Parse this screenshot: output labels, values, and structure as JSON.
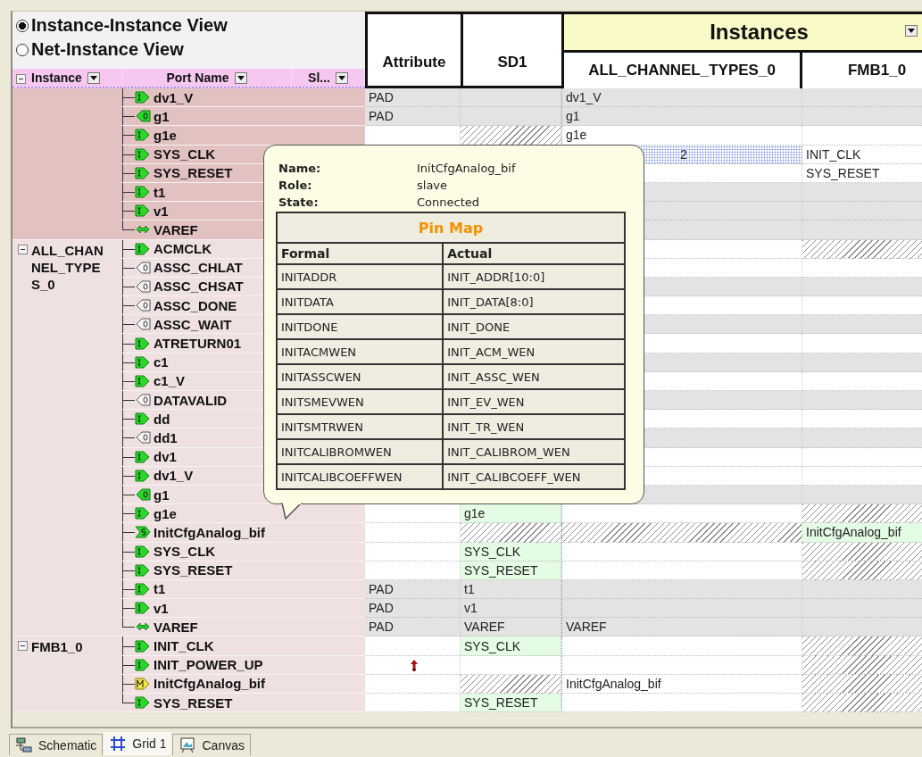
{
  "view_options": [
    {
      "label": "Instance-Instance View",
      "selected": true
    },
    {
      "label": "Net-Instance View",
      "selected": false
    }
  ],
  "left_columns": [
    "Instance",
    "Port Name",
    "Sl..."
  ],
  "right_columns": {
    "attribute": "Attribute",
    "sd1": "SD1",
    "group": "Instances",
    "instances": [
      "ALL_CHANNEL_TYPES_0",
      "FMB1_0"
    ]
  },
  "groups": [
    {
      "highlighted": true,
      "ports": [
        {
          "name": "dv1_V",
          "kind": "in",
          "cells": [
            {
              "kind": "gray",
              "text": "PAD"
            },
            {
              "kind": "gray"
            },
            {
              "kind": "gray",
              "text": "dv1_V"
            },
            {
              "kind": "gray"
            }
          ]
        },
        {
          "name": "g1",
          "kind": "out",
          "cells": [
            {
              "kind": "gray",
              "text": "PAD"
            },
            {
              "kind": "gray"
            },
            {
              "kind": "gray",
              "text": "g1"
            },
            {
              "kind": "gray"
            }
          ]
        },
        {
          "name": "g1e",
          "kind": "in",
          "cells": [
            {
              "kind": "plain"
            },
            {
              "kind": "hatch"
            },
            {
              "kind": "plain",
              "text": "g1e"
            },
            {
              "kind": "plain"
            }
          ]
        },
        {
          "name": "SYS_CLK",
          "kind": "in",
          "cells": [
            null,
            null,
            {
              "kind": "dots",
              "text": "2"
            },
            {
              "kind": "plain",
              "text": "INIT_CLK"
            }
          ]
        },
        {
          "name": "SYS_RESET",
          "kind": "in",
          "cells": [
            null,
            null,
            {
              "kind": "plain"
            },
            {
              "kind": "plain",
              "text": "SYS_RESET"
            }
          ]
        },
        {
          "name": "t1",
          "kind": "in",
          "cells": [
            null,
            null,
            {
              "kind": "gray"
            },
            {
              "kind": "gray"
            }
          ]
        },
        {
          "name": "v1",
          "kind": "in",
          "cells": [
            null,
            null,
            {
              "kind": "gray"
            },
            {
              "kind": "gray"
            }
          ]
        },
        {
          "name": "VAREF",
          "kind": "inout",
          "cells": [
            null,
            null,
            {
              "kind": "gray"
            },
            {
              "kind": "gray"
            }
          ]
        }
      ]
    },
    {
      "instance": "ALL_CHANNEL_TYPES_0",
      "highlighted": false,
      "expanded": true,
      "ports": [
        {
          "name": "ACMCLK",
          "kind": "in",
          "cells": [
            null,
            null,
            {
              "kind": "plain"
            },
            {
              "kind": "hatch"
            }
          ]
        },
        {
          "name": "ASSC_CHLAT",
          "kind": "floating",
          "cells": [
            null,
            null,
            {
              "kind": "plain"
            },
            {
              "kind": "plain"
            }
          ]
        },
        {
          "name": "ASSC_CHSAT",
          "kind": "floating",
          "cells": [
            null,
            null,
            {
              "kind": "gray"
            },
            {
              "kind": "gray"
            }
          ]
        },
        {
          "name": "ASSC_DONE",
          "kind": "floating",
          "cells": [
            null,
            null,
            {
              "kind": "plain"
            },
            {
              "kind": "plain"
            }
          ]
        },
        {
          "name": "ASSC_WAIT",
          "kind": "floating",
          "cells": [
            null,
            null,
            {
              "kind": "gray"
            },
            {
              "kind": "gray"
            }
          ]
        },
        {
          "name": "ATRETURN01",
          "kind": "in",
          "cells": [
            null,
            null,
            {
              "kind": "plain"
            },
            {
              "kind": "plain"
            }
          ]
        },
        {
          "name": "c1",
          "kind": "in",
          "cells": [
            null,
            null,
            {
              "kind": "gray"
            },
            {
              "kind": "gray"
            }
          ]
        },
        {
          "name": "c1_V",
          "kind": "in",
          "cells": [
            null,
            null,
            {
              "kind": "plain"
            },
            {
              "kind": "plain"
            }
          ]
        },
        {
          "name": "DATAVALID",
          "kind": "floating",
          "cells": [
            null,
            null,
            {
              "kind": "gray"
            },
            {
              "kind": "gray"
            }
          ]
        },
        {
          "name": "dd",
          "kind": "in",
          "cells": [
            null,
            null,
            {
              "kind": "plain"
            },
            {
              "kind": "plain"
            }
          ]
        },
        {
          "name": "dd1",
          "kind": "floating",
          "cells": [
            null,
            null,
            {
              "kind": "gray"
            },
            {
              "kind": "gray"
            }
          ]
        },
        {
          "name": "dv1",
          "kind": "in",
          "cells": [
            null,
            null,
            {
              "kind": "plain"
            },
            {
              "kind": "plain"
            }
          ]
        },
        {
          "name": "dv1_V",
          "kind": "in",
          "cells": [
            null,
            null,
            {
              "kind": "plain"
            },
            {
              "kind": "plain"
            }
          ]
        },
        {
          "name": "g1",
          "kind": "out",
          "cells": [
            null,
            null,
            {
              "kind": "gray"
            },
            {
              "kind": "gray"
            }
          ]
        },
        {
          "name": "g1e",
          "kind": "in",
          "cells": [
            {
              "kind": "plain"
            },
            {
              "kind": "green",
              "text": "g1e"
            },
            {
              "kind": "plain"
            },
            {
              "kind": "hatch"
            }
          ]
        },
        {
          "name": "InitCfgAnalog_bif",
          "kind": "slave",
          "cells": [
            {
              "kind": "plain"
            },
            {
              "kind": "hatch"
            },
            {
              "kind": "hatch"
            },
            {
              "kind": "green",
              "text": "InitCfgAnalog_bif"
            }
          ]
        },
        {
          "name": "SYS_CLK",
          "kind": "in",
          "cells": [
            {
              "kind": "plain"
            },
            {
              "kind": "green",
              "text": "SYS_CLK"
            },
            {
              "kind": "plain"
            },
            {
              "kind": "hatch"
            }
          ]
        },
        {
          "name": "SYS_RESET",
          "kind": "in",
          "cells": [
            {
              "kind": "plain"
            },
            {
              "kind": "green",
              "text": "SYS_RESET"
            },
            {
              "kind": "plain"
            },
            {
              "kind": "hatch"
            }
          ]
        },
        {
          "name": "t1",
          "kind": "in",
          "cells": [
            {
              "kind": "gray",
              "text": "PAD"
            },
            {
              "kind": "gray",
              "text": "t1"
            },
            {
              "kind": "gray"
            },
            {
              "kind": "gray"
            }
          ]
        },
        {
          "name": "v1",
          "kind": "in",
          "cells": [
            {
              "kind": "gray",
              "text": "PAD"
            },
            {
              "kind": "gray",
              "text": "v1"
            },
            {
              "kind": "gray"
            },
            {
              "kind": "gray"
            }
          ]
        },
        {
          "name": "VAREF",
          "kind": "inout",
          "cells": [
            {
              "kind": "gray",
              "text": "PAD"
            },
            {
              "kind": "gray",
              "text": "VAREF"
            },
            {
              "kind": "gray",
              "text": "VAREF"
            },
            {
              "kind": "gray"
            }
          ]
        }
      ]
    },
    {
      "instance": "FMB1_0",
      "highlighted": false,
      "expanded": true,
      "ports": [
        {
          "name": "INIT_CLK",
          "kind": "in",
          "cells": [
            {
              "kind": "plain"
            },
            {
              "kind": "green",
              "text": "SYS_CLK"
            },
            {
              "kind": "plain"
            },
            {
              "kind": "hatch"
            }
          ]
        },
        {
          "name": "INIT_POWER_UP",
          "kind": "in",
          "cells": [
            {
              "kind": "marker"
            },
            {
              "kind": "plain"
            },
            {
              "kind": "plain"
            },
            {
              "kind": "hatch"
            }
          ]
        },
        {
          "name": "InitCfgAnalog_bif",
          "kind": "master",
          "cells": [
            {
              "kind": "plain"
            },
            {
              "kind": "hatch"
            },
            {
              "kind": "plain",
              "text": "InitCfgAnalog_bif"
            },
            {
              "kind": "hatch"
            }
          ]
        },
        {
          "name": "SYS_RESET",
          "kind": "in",
          "cells": [
            {
              "kind": "plain"
            },
            {
              "kind": "green",
              "text": "SYS_RESET"
            },
            {
              "kind": "plain"
            },
            {
              "kind": "hatch"
            }
          ]
        }
      ]
    }
  ],
  "tooltip": {
    "fields": [
      {
        "label": "Name:",
        "value": "InitCfgAnalog_bif"
      },
      {
        "label": "Role:",
        "value": "slave"
      },
      {
        "label": "State:",
        "value": "Connected"
      }
    ],
    "table": {
      "title": "Pin Map",
      "columns": [
        "Formal",
        "Actual"
      ],
      "rows": [
        [
          "INITADDR",
          "INIT_ADDR[10:0]"
        ],
        [
          "INITDATA",
          "INIT_DATA[8:0]"
        ],
        [
          "INITDONE",
          "INIT_DONE"
        ],
        [
          "INITACMWEN",
          "INIT_ACM_WEN"
        ],
        [
          "INITASSCWEN",
          "INIT_ASSC_WEN"
        ],
        [
          "INITSMEVWEN",
          "INIT_EV_WEN"
        ],
        [
          "INITSMTRWEN",
          "INIT_TR_WEN"
        ],
        [
          "INITCALIBROMWEN",
          "INIT_CALIBROM_WEN"
        ],
        [
          "INITCALIBCOEFFWEN",
          "INIT_CALIBCOEFF_WEN"
        ]
      ]
    }
  },
  "tabs": [
    {
      "label": "Schematic",
      "selected": false
    },
    {
      "label": "Grid 1",
      "selected": true
    },
    {
      "label": "Canvas",
      "selected": false
    }
  ]
}
